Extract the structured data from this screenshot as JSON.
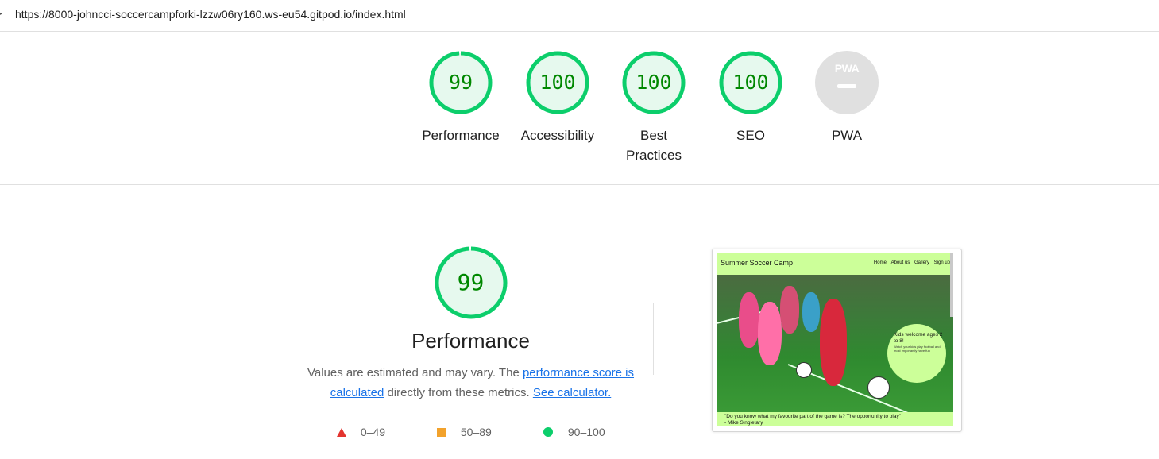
{
  "address_bar": {
    "url": "https://8000-johncci-soccercampforki-lzzw06ry160.ws-eu54.gitpod.io/index.html"
  },
  "colors": {
    "pass": "#0cce6b",
    "pass_text": "#008800",
    "pass_bg": "#e6f9ee",
    "average": "#f2a22c",
    "fail": "#e3342f",
    "na": "#e0e0e0",
    "link": "#1a73e8"
  },
  "summary": [
    {
      "label": "Performance",
      "score": "99",
      "value": 99
    },
    {
      "label": "Accessibility",
      "score": "100",
      "value": 100
    },
    {
      "label": "Best Practices",
      "score": "100",
      "value": 100
    },
    {
      "label": "SEO",
      "score": "100",
      "value": 100
    },
    {
      "label": "PWA",
      "score": "",
      "value": null,
      "icon": "pwa-icon",
      "icon_text": "PWA"
    }
  ],
  "performance": {
    "score": "99",
    "value": 99,
    "title": "Performance",
    "desc_prefix": "Values are estimated and may vary. The ",
    "link1": "performance score is calculated",
    "desc_mid": " directly from these metrics. ",
    "link2": "See calculator."
  },
  "legend": [
    {
      "range": "0–49",
      "icon": "red-triangle-icon"
    },
    {
      "range": "50–89",
      "icon": "orange-square-icon"
    },
    {
      "range": "90–100",
      "icon": "green-circle-icon"
    }
  ],
  "screenshot": {
    "brand": "Summer Soccer Camp",
    "nav": [
      "Home",
      "About us",
      "Gallery",
      "Sign up"
    ],
    "bubble_title": "Kids welcome ages 2 to 8!",
    "bubble_text": "Watch your kids play football and most importantly have fun",
    "quote": "\"Do you know what my favourite part of the game is? The opportunity to play\"",
    "author": "- Mike Singletary"
  }
}
